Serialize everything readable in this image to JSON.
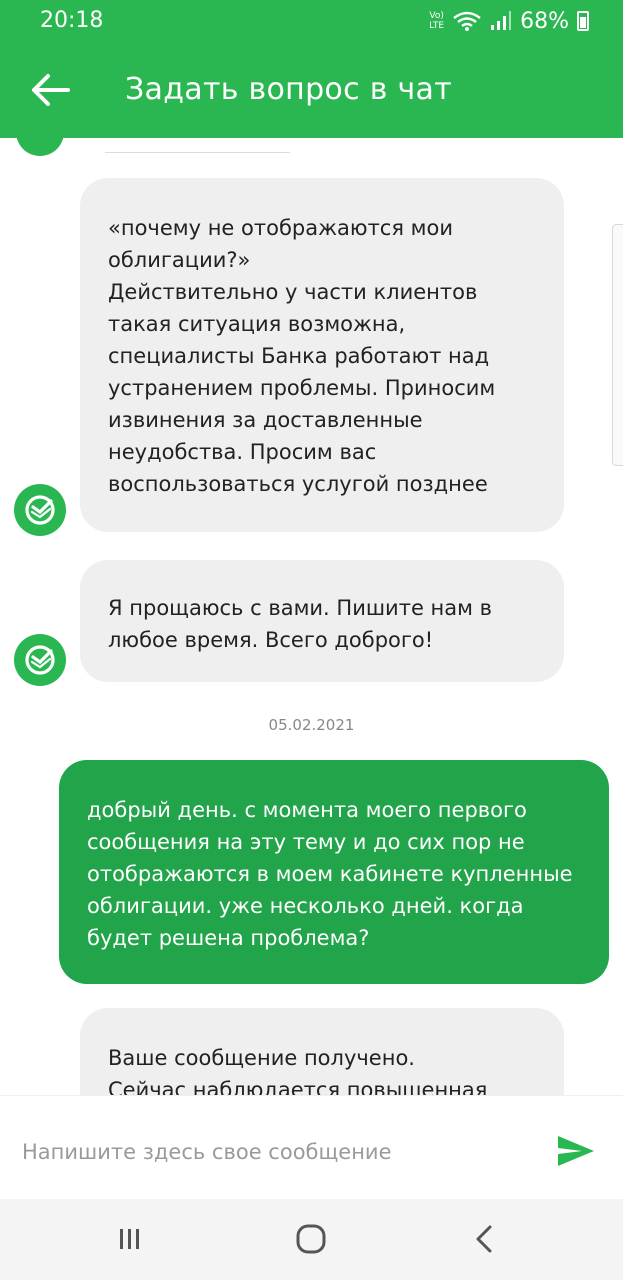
{
  "status_bar": {
    "time": "20:18",
    "volte_top": "Vo)",
    "volte_bottom": "LTE",
    "battery_percent": "68%",
    "battery_level": 0.68
  },
  "header": {
    "title": "Задать вопрос в чат",
    "back_icon": "arrow-left-icon"
  },
  "messages": [
    {
      "direction": "incoming",
      "text": "«почему не отображаются мои облигации?»\nДействительно у части клиентов такая ситуация возможна, специалисты Банка работают над устранением проблемы. Приносим извинения за доставленные неудобства. Просим вас воспользоваться услугой позднее"
    },
    {
      "direction": "incoming",
      "text": "Я прощаюсь с вами. Пишите нам в любое время. Всего доброго!"
    },
    {
      "direction": "outgoing",
      "text": "добрый день. с момента моего первого сообщения на эту тему и до сих пор не отображаются в моем кабинете купленные облигации. уже несколько дней. когда будет решена проблема?"
    },
    {
      "direction": "incoming",
      "text": "Ваше сообщение получено.\nСейчас наблюдается повышенная"
    }
  ],
  "date_separator": "05.02.2021",
  "composer": {
    "placeholder": "Напишите здесь свое сообщение",
    "send_icon": "send-icon"
  },
  "nav": {
    "recents_icon": "recent-apps-icon",
    "home_icon": "home-icon",
    "back_icon": "back-chevron-icon"
  },
  "colors": {
    "brand": "#2ab752",
    "outgoing_bubble": "#21a44a",
    "incoming_bubble": "#efefef"
  }
}
